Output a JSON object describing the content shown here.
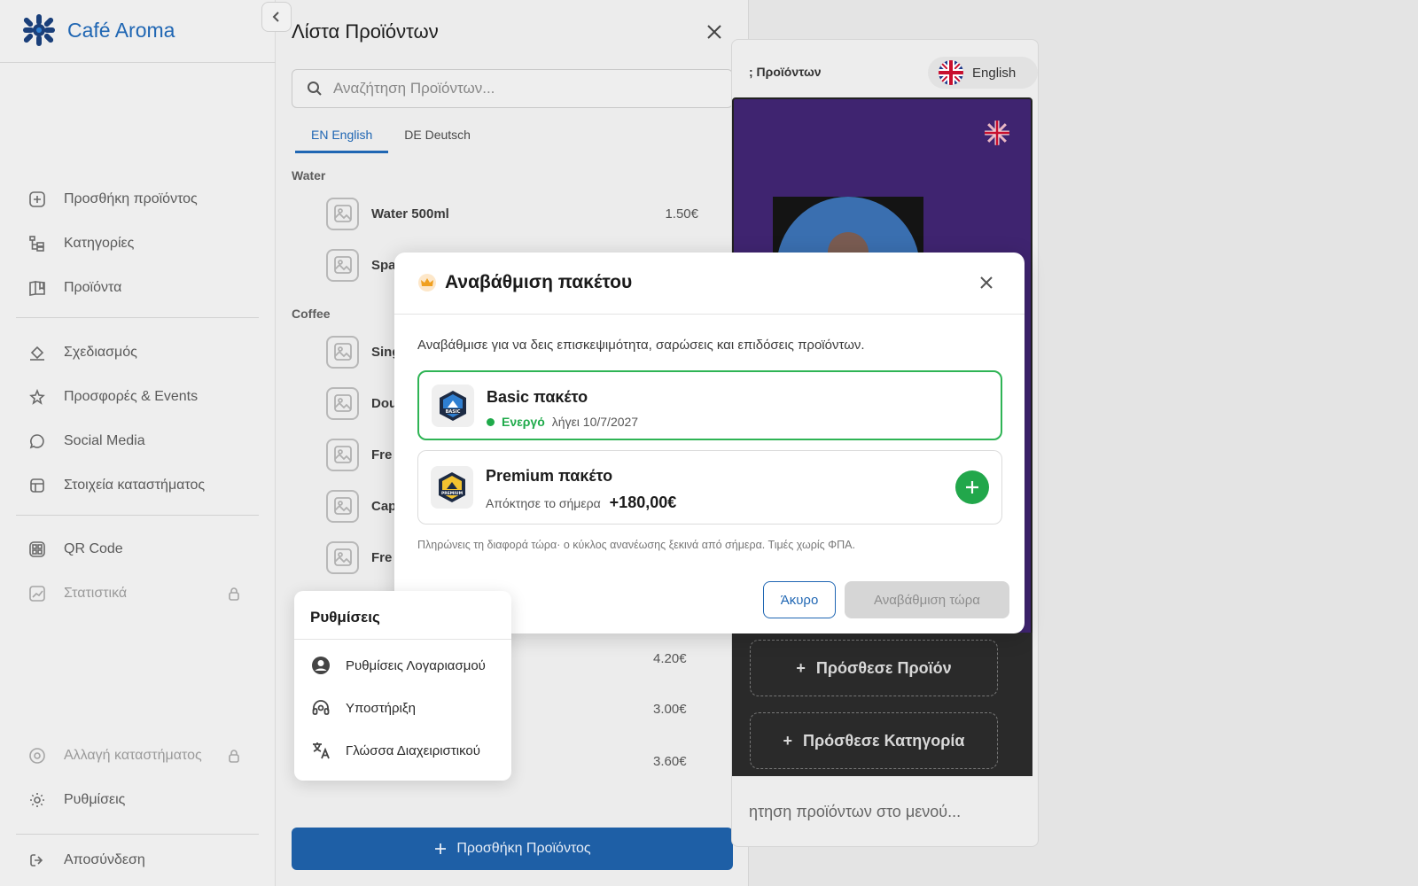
{
  "brand": {
    "name": "Café Aroma"
  },
  "sidebar": {
    "items": [
      {
        "label": "Προσθήκη προϊόντος",
        "icon": "plus-square-icon"
      },
      {
        "label": "Κατηγορίες",
        "icon": "category-tree-icon"
      },
      {
        "label": "Προϊόντα",
        "icon": "menu-book-icon"
      },
      {
        "label": "Σχεδιασμός",
        "icon": "paint-bucket-icon"
      },
      {
        "label": "Προσφορές & Events",
        "icon": "star-sparkle-icon"
      },
      {
        "label": "Social Media",
        "icon": "chat-bubble-icon"
      },
      {
        "label": "Στοιχεία καταστήματος",
        "icon": "store-icon"
      },
      {
        "label": "QR Code",
        "icon": "qr-code-icon"
      },
      {
        "label": "Στατιστικά",
        "icon": "chart-icon"
      },
      {
        "label": "Αλλαγή καταστήματος",
        "icon": "switch-store-icon"
      },
      {
        "label": "Ρυθμίσεις",
        "icon": "gear-icon"
      },
      {
        "label": "Αποσύνδεση",
        "icon": "logout-icon"
      }
    ]
  },
  "panel": {
    "title": "Λίστα Προϊόντων",
    "search_placeholder": "Αναζήτηση Προϊόντων...",
    "tabs": [
      {
        "label": "EN English"
      },
      {
        "label": "DE Deutsch"
      }
    ],
    "categories": [
      {
        "name": "Water"
      },
      {
        "name": "Coffee"
      }
    ],
    "products": [
      {
        "name": "Water 500ml",
        "price": "1.50€"
      },
      {
        "name": "Spa",
        "price": ""
      },
      {
        "name": "Sing",
        "price": ""
      },
      {
        "name": "Dou",
        "price": ""
      },
      {
        "name": "Fre",
        "price": ""
      },
      {
        "name": "Cap",
        "price": ""
      },
      {
        "name": "Fre",
        "price": ""
      }
    ],
    "hidden_prices": [
      "4.20€",
      "3.00€",
      "3.60€"
    ],
    "add_button": "Προσθήκη Προϊόντος"
  },
  "preview": {
    "tab_text": "; Προϊόντων",
    "language": "English",
    "add_product": "Πρόσθεσε Προϊόν",
    "add_category": "Πρόσθεσε Κατηγορία",
    "search_text": "ητηση προϊόντων στο μενού..."
  },
  "modal": {
    "title": "Αναβάθμιση πακέτου",
    "description": "Αναβάθμισε για να δεις επισκεψιμότητα, σαρώσεις και επιδόσεις προϊόντων.",
    "plans": [
      {
        "name": "Basic πακέτο",
        "status": "Ενεργό",
        "expires": "λήγει 10/7/2027",
        "badge": "BASIC"
      },
      {
        "name": "Premium πακέτο",
        "subtitle": "Απόκτησε το σήμερα",
        "price": "+180,00€",
        "badge": "PREMIUM"
      }
    ],
    "note": "Πληρώνεις τη διαφορά τώρα· ο κύκλος ανανέωσης ξεκινά από σήμερα. Τιμές χωρίς ΦΠΑ.",
    "cancel": "Άκυρο",
    "upgrade": "Αναβάθμιση τώρα"
  },
  "settings_popover": {
    "title": "Ρυθμίσεις",
    "items": [
      {
        "label": "Ρυθμίσεις Λογαριασμού",
        "icon": "account-circle-icon"
      },
      {
        "label": "Υποστήριξη",
        "icon": "support-headset-icon"
      },
      {
        "label": "Γλώσσα Διαχειριστικού",
        "icon": "translate-icon"
      }
    ]
  },
  "colors": {
    "accent": "#1f66b3",
    "active_green": "#2fb455",
    "phone_bg": "#3f2470",
    "primary_button": "#1e5fa6"
  }
}
